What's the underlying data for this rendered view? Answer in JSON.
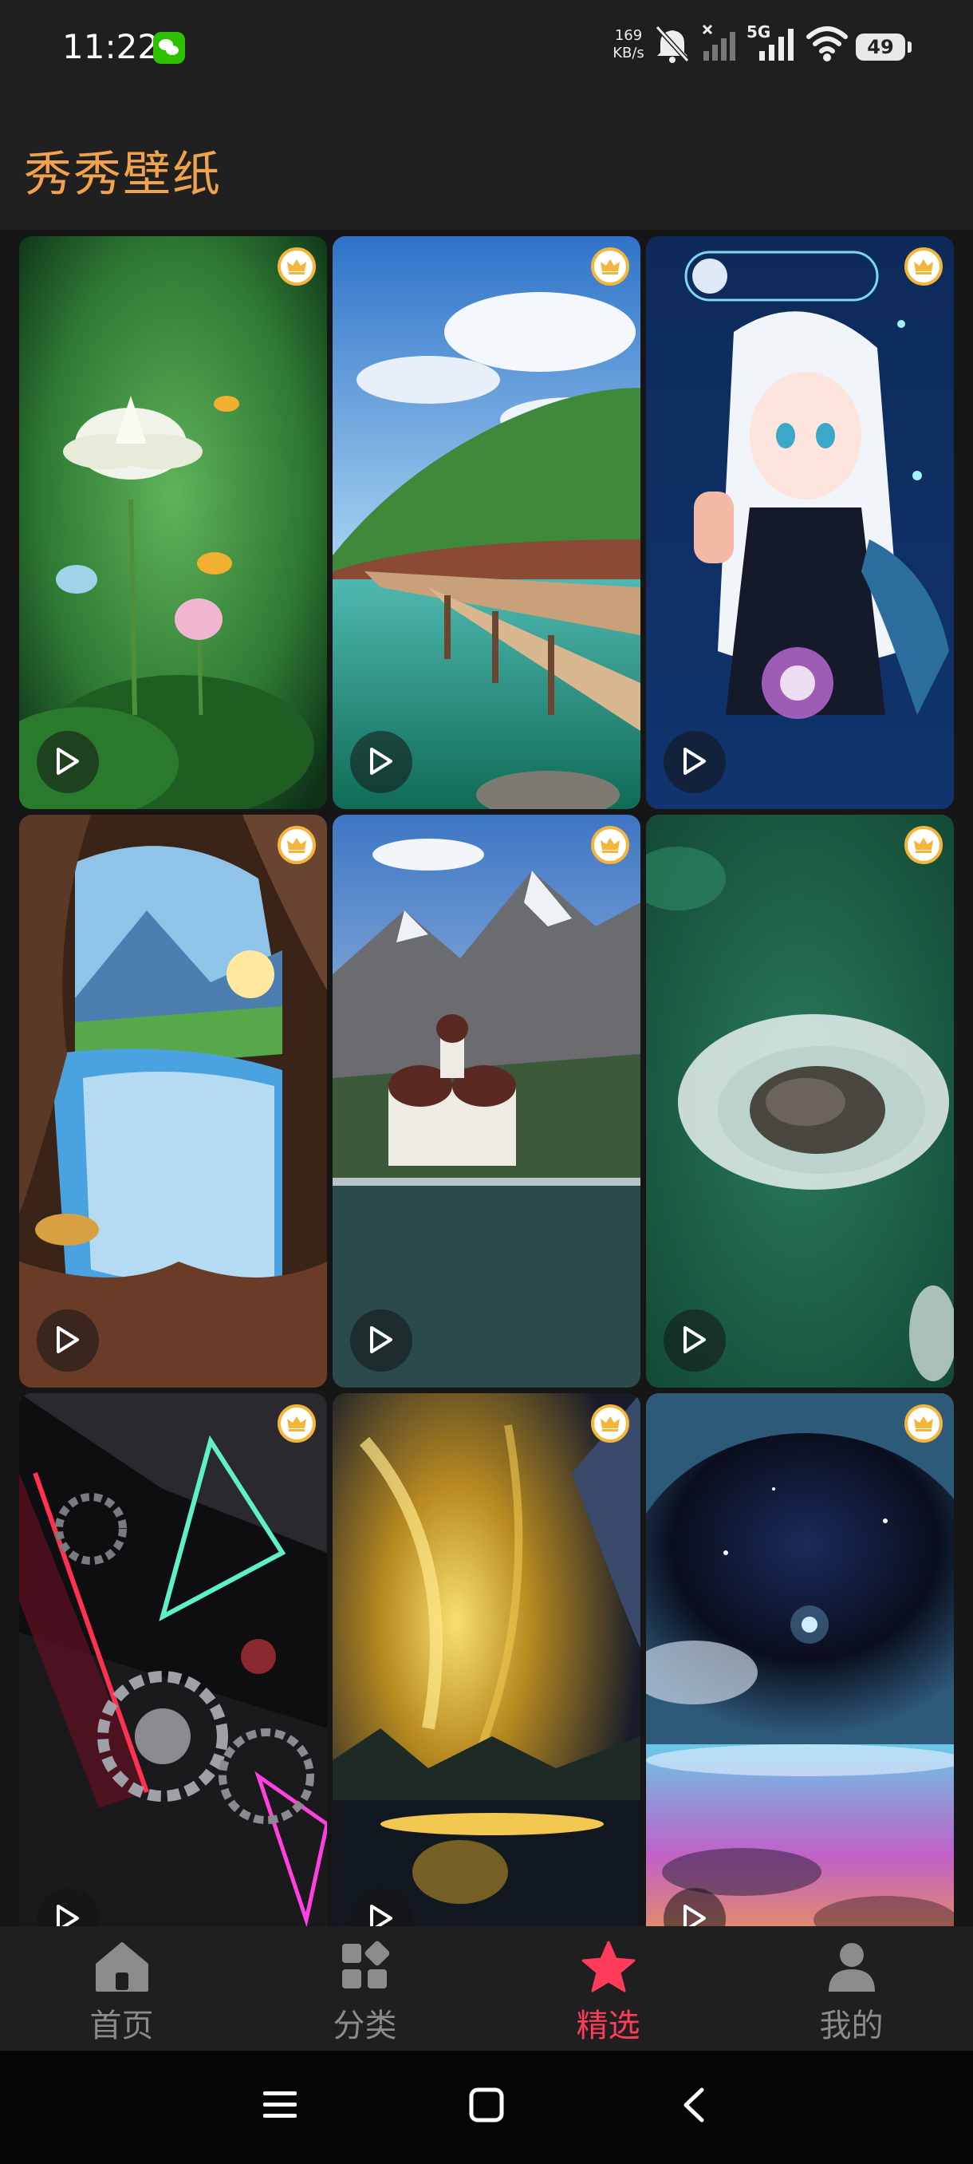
{
  "status": {
    "time": "11:22",
    "net_speed_value": "169",
    "net_speed_unit": "KB/s",
    "network_label": "5G",
    "battery": "49"
  },
  "app": {
    "title": "秀秀壁纸"
  },
  "wallpapers": [
    {
      "theme": "lotus-pond-goldfish",
      "premium": true,
      "video": true
    },
    {
      "theme": "lake-boardwalk-cliff",
      "premium": true,
      "video": true
    },
    {
      "theme": "anime-white-hair-girl",
      "premium": true,
      "video": true
    },
    {
      "theme": "cave-waterfall-sunset",
      "premium": true,
      "video": true
    },
    {
      "theme": "alpine-church-lake",
      "premium": true,
      "video": true
    },
    {
      "theme": "aerial-ocean-rock",
      "premium": true,
      "video": true
    },
    {
      "theme": "neon-gears-abstract",
      "premium": true,
      "video": true
    },
    {
      "theme": "golden-sky-reflection",
      "premium": true,
      "video": true
    },
    {
      "theme": "cosmic-eye-galaxy",
      "premium": true,
      "video": true
    }
  ],
  "tabs": [
    {
      "label": "首页",
      "icon": "home-icon",
      "active": false
    },
    {
      "label": "分类",
      "icon": "category-icon",
      "active": false
    },
    {
      "label": "精选",
      "icon": "star-icon",
      "active": true
    },
    {
      "label": "我的",
      "icon": "profile-icon",
      "active": false
    }
  ],
  "colors": {
    "accent_title": "#f2a24c",
    "active_tab": "#ff3b5a",
    "inactive_tab": "#8b8b8b",
    "crown_gold": "#f5b43a"
  }
}
